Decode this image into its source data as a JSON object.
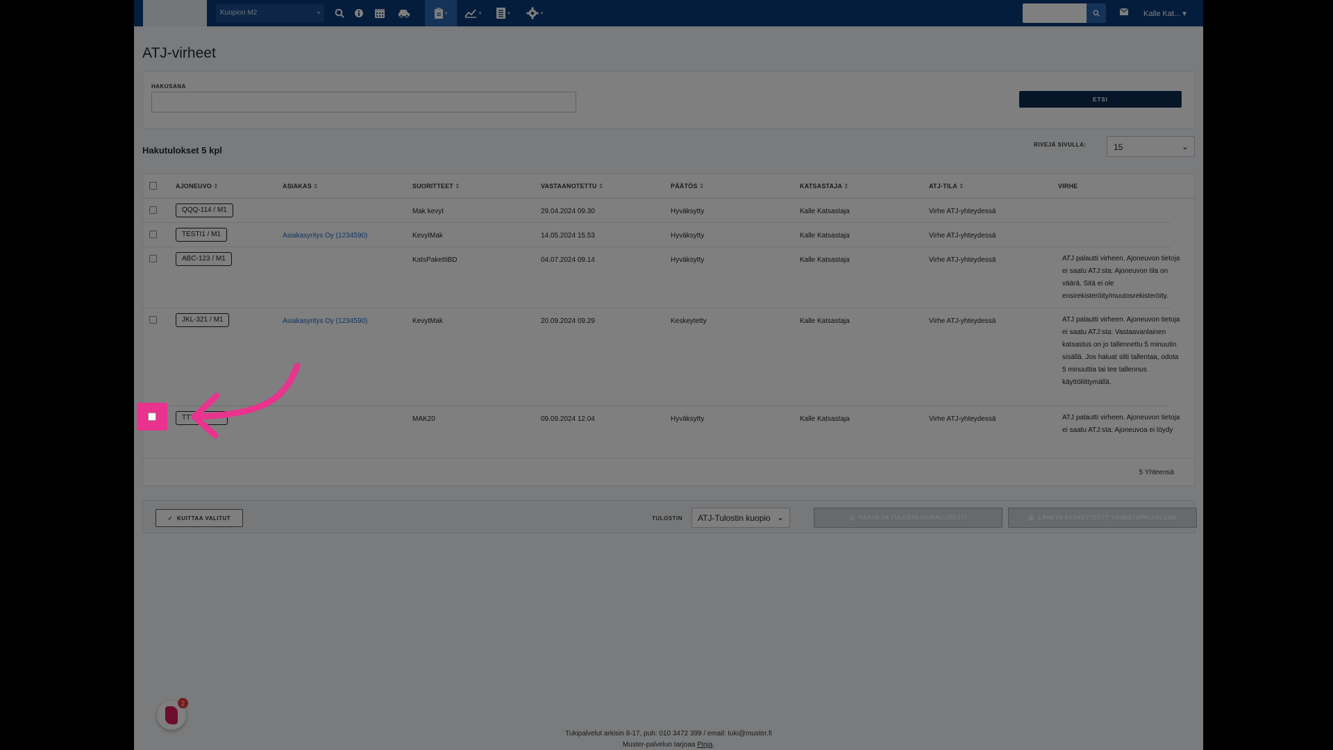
{
  "nav": {
    "location": "Kuopion M2",
    "icons": [
      "search-icon",
      "info-icon",
      "calendar-icon",
      "car-icon",
      "clipboard-icon",
      "chart-icon",
      "list-icon",
      "gear-icon"
    ],
    "user_name": "Kalle Kat..."
  },
  "page": {
    "title": "ATJ-virheet",
    "search_label": "HAKUSANA",
    "search_value": "",
    "search_button": "ETSI",
    "result_count": "Hakutulokset 5 kpl",
    "rows_per_page_label": "RIVEJÄ SIVULLA:",
    "rows_per_page": "15"
  },
  "table": {
    "headers": [
      "AJONEUVO",
      "ASIAKAS",
      "SUORITTEET",
      "VASTAANOTETTU",
      "PÄÄTÖS",
      "KATSASTAJA",
      "ATJ-TILA",
      "VIRHE"
    ],
    "rows": [
      {
        "plate": "QQQ-114 / M1",
        "customer": "",
        "service": "Mak kevyt",
        "received": "29.04.2024 09.30",
        "decision": "Hyväksytty",
        "inspector": "Kalle Katsastaja",
        "atj_state": "Virhe ATJ-yhteydessä",
        "error": ""
      },
      {
        "plate": "TESTI1 / M1",
        "customer": "Asiakasyritys Oy (1234590)",
        "service": "KevytMak",
        "received": "14.05.2024 15.53",
        "decision": "Hyväksytty",
        "inspector": "Kalle Katsastaja",
        "atj_state": "Virhe ATJ-yhteydessä",
        "error": ""
      },
      {
        "plate": "ABC-123 / M1",
        "customer": "",
        "service": "KatsPakettiBD",
        "received": "04.07.2024 09.14",
        "decision": "Hyväksytty",
        "inspector": "Kalle Katsastaja",
        "atj_state": "Virhe ATJ-yhteydessä",
        "error": "ATJ palautti virheen. Ajoneuvon tietoja ei saatu ATJ:sta: Ajoneuvon tila on väärä. Sitä ei ole ensirekisteröity/muutosrekisteröity."
      },
      {
        "plate": "JKL-321 / M1",
        "customer": "Asiakasyritys Oy (1234590)",
        "service": "KevytMak",
        "received": "20.09.2024 09.29",
        "decision": "Keskeytetty",
        "inspector": "Kalle Katsastaja",
        "atj_state": "Virhe ATJ-yhteydessä",
        "error": "ATJ palautti virheen. Ajoneuvon tietoja ei saatu ATJ:sta: Vastaavanlainen katsastus on jo tallennettu 5 minuutin sisällä. Jos haluat silti tallentaa, odota 5 minuuttia tai tee tallennus käyttöliittymällä."
      },
      {
        "plate": "TTT",
        "customer": "",
        "service": "MAK20",
        "received": "09.09.2024 12.04",
        "decision": "Hyväksytty",
        "inspector": "Kalle Katsastaja",
        "atj_state": "Virhe ATJ-yhteydessä",
        "error": "ATJ palautti virheen. Ajoneuvon tietoja ei saatu ATJ:sta: Ajoneuvoa ei löydy"
      }
    ],
    "total": "5 Yhteensä"
  },
  "actions": {
    "acknowledge": "KUITTAA VALITUT",
    "printer_label": "TULOSTIN",
    "printer": "ATJ-Tulostin kuopio",
    "close_print": "PÄÄTÄ JA TULOSTA PAIKALLISESTI",
    "send_interrupted": "LÄHETÄ KESKEYTETYT TOIMISTOPALVELUUN"
  },
  "footer": {
    "line1": "Tukipalvelut arkisin 8-17, puh: 010 3472 399 / email: tuki@muster.fi",
    "line2_prefix": "Muster-palvelun tarjoaa",
    "line2_link": "Pinja",
    "line2_suffix": "."
  },
  "chat": {
    "badge": "2"
  },
  "overlay": {
    "highlight_color": "#e9338f"
  }
}
